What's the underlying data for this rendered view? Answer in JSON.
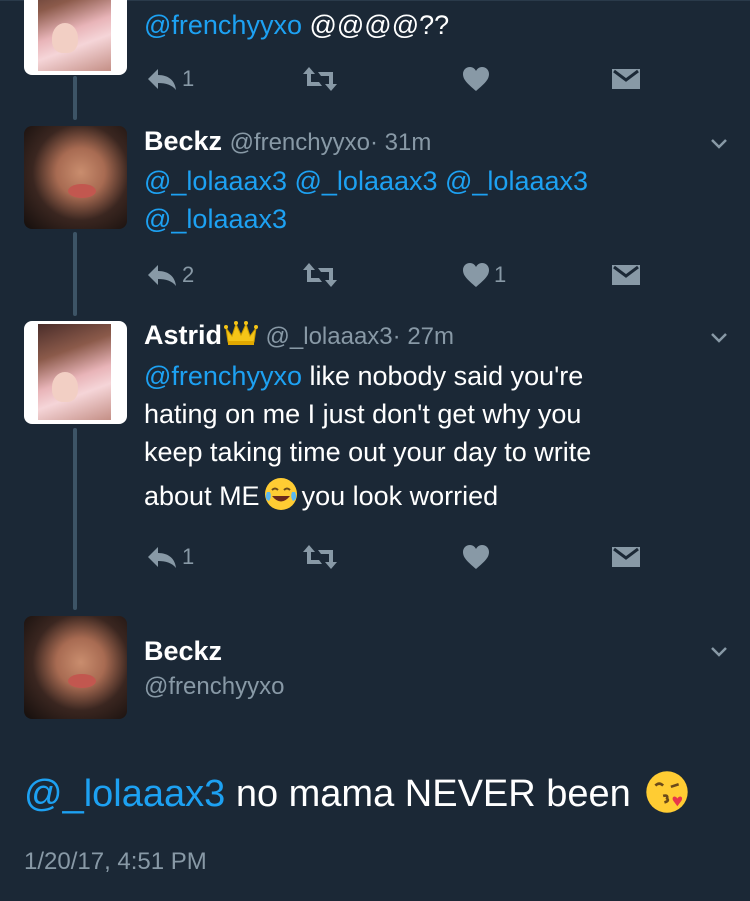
{
  "colors": {
    "background": "#1b2836",
    "mention": "#1da1f2",
    "muted": "#8899a6"
  },
  "tweets": [
    {
      "avatar": "framed-photo",
      "name": "",
      "handle": "",
      "time": "",
      "mention": "@frenchyyxo",
      "text": " @@@@??",
      "reply_count": "1",
      "like_count": ""
    },
    {
      "avatar": "dark-photo",
      "name": "Beckz",
      "handle": "@frenchyyxo",
      "time": "· 31m",
      "line1": "@_lolaaax3 @_lolaaax3 @_lolaaax3",
      "line2": "@_lolaaax3",
      "reply_count": "2",
      "like_count": "1"
    },
    {
      "avatar": "framed-photo",
      "name": "Astrid",
      "name_emoji": "crown",
      "handle": "@_lolaaax3",
      "time": "· 27m",
      "mention": "@frenchyyxo",
      "text1": " like nobody said you're",
      "text2": "hating on me I just don't get why you",
      "text3": "keep taking time out your day to write",
      "text4a": "about ME",
      "text4_emoji": "face-with-tears-of-joy",
      "text4b": "you look worried",
      "reply_count": "1",
      "like_count": ""
    }
  ],
  "focus": {
    "name": "Beckz",
    "handle": "@frenchyyxo",
    "mention": "@_lolaaax3",
    "text": " no mama NEVER been ",
    "emoji": "face-blowing-a-kiss",
    "timestamp": "1/20/17, 4:51 PM"
  }
}
